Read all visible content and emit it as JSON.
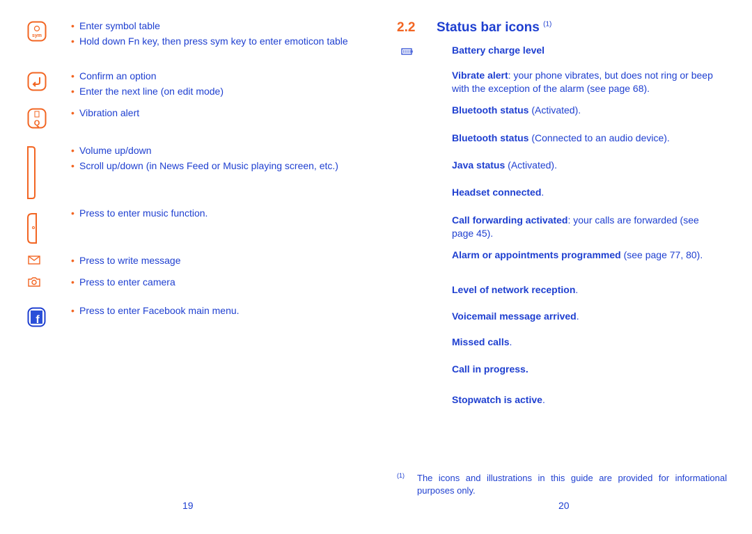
{
  "left_page": {
    "page_number": "19",
    "items": [
      {
        "icon": "sym-key-icon",
        "bullets": [
          "Enter symbol table",
          "Hold down Fn key, then press sym key to enter emoticon table"
        ]
      },
      {
        "icon": "enter-key-icon",
        "bullets": [
          "Confirm an option",
          "Enter the next line (on edit mode)"
        ]
      },
      {
        "icon": "vibration-key-icon",
        "bullets": [
          "Vibration alert"
        ]
      },
      {
        "icon": "volume-side-key-icon",
        "bullets": [
          "Volume up/down",
          "Scroll up/down (in News Feed or Music playing screen, etc.)"
        ]
      },
      {
        "icon": "music-side-key-icon",
        "bullets": [
          "Press to enter music function."
        ]
      },
      {
        "icon": "message-icon",
        "bullets": [
          "Press to write message"
        ]
      },
      {
        "icon": "camera-icon",
        "bullets": [
          "Press to enter camera"
        ]
      },
      {
        "icon": "facebook-icon",
        "bullets": [
          "Press to enter Facebook main menu."
        ]
      }
    ]
  },
  "right_page": {
    "page_number": "20",
    "section_number": "2.2",
    "section_title": "Status bar icons",
    "section_footnote_mark": "(1)",
    "entries": [
      {
        "bold": "Battery charge level",
        "rest": ""
      },
      {
        "bold": "Vibrate alert",
        "rest": ": your phone vibrates, but does not ring or beep with the exception of the alarm (see page 68)."
      },
      {
        "bold": "Bluetooth status",
        "rest": " (Activated)."
      },
      {
        "bold": "Bluetooth status",
        "rest": " (Connected to an audio device)."
      },
      {
        "bold": "Java status",
        "rest": " (Activated)."
      },
      {
        "bold": "Headset connected",
        "rest": "."
      },
      {
        "bold": "Call forwarding activated",
        "rest": ": your calls are forwarded (see page 45)."
      },
      {
        "bold": "Alarm or appointments programmed",
        "rest": " (see page 77, 80)."
      },
      {
        "bold": "Level of network reception",
        "rest": "."
      },
      {
        "bold": "Voicemail message arrived",
        "rest": "."
      },
      {
        "bold": "Missed calls",
        "rest": "."
      },
      {
        "bold": "Call in progress",
        "rest": "."
      },
      {
        "bold": "Stopwatch is active",
        "rest": "."
      }
    ],
    "footnote_mark": "(1)",
    "footnote": "The icons and illustrations in this guide are provided for informational purposes only."
  },
  "colors": {
    "text": "#1e3fd0",
    "accent": "#f26522"
  }
}
